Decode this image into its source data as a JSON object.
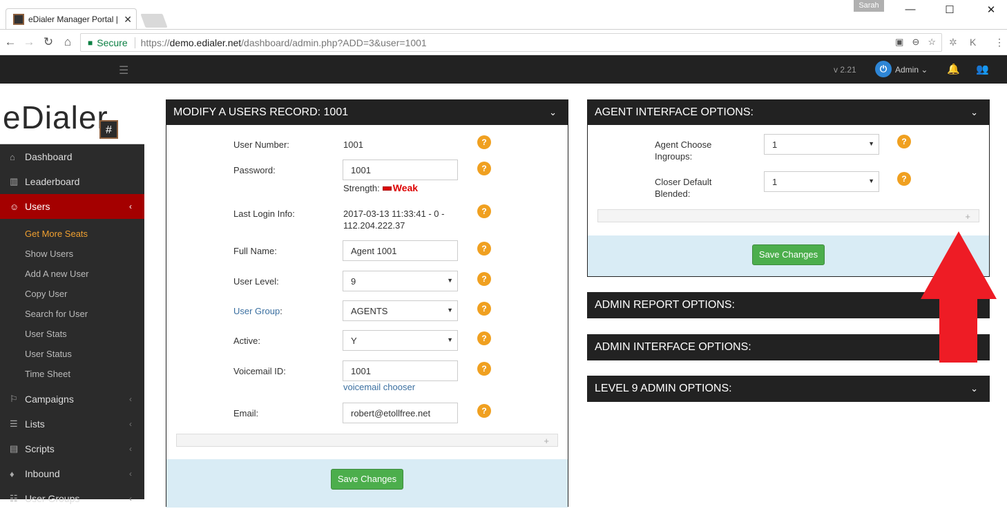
{
  "browser": {
    "tab_title": "eDialer Manager Portal |",
    "tab_close": "✕",
    "profile_name": "Sarah",
    "win_min": "—",
    "win_max": "☐",
    "win_close": "✕",
    "secure_label": "Secure",
    "url_scheme": "https://",
    "url_host": "demo.edialer.net",
    "url_path": "/dashboard/admin.php?ADD=3&user=1001"
  },
  "topbar": {
    "version": "v 2.21",
    "user_label": "Admin ⌄"
  },
  "sidebar": {
    "logo_text": "eDialer",
    "logo_hash": "#",
    "items": [
      {
        "label": "Dashboard",
        "icon": "⌂"
      },
      {
        "label": "Leaderboard",
        "icon": "▥"
      },
      {
        "label": "Users",
        "icon": "☺",
        "chev": "‹"
      },
      {
        "label": "Campaigns",
        "icon": "⚐",
        "chev": "‹"
      },
      {
        "label": "Lists",
        "icon": "☰",
        "chev": "‹"
      },
      {
        "label": "Scripts",
        "icon": "▤",
        "chev": "‹"
      },
      {
        "label": "Inbound",
        "icon": "♦",
        "chev": "‹"
      },
      {
        "label": "User Groups",
        "icon": "☷",
        "chev": "‹"
      }
    ],
    "sub_items": [
      "Get More Seats",
      "Show Users",
      "Add A new User",
      "Copy User",
      "Search for User",
      "User Stats",
      "User Status",
      "Time Sheet"
    ]
  },
  "modify_panel": {
    "title": "MODIFY A USERS RECORD: 1001",
    "user_number_label": "User Number:",
    "user_number_value": "1001",
    "password_label": "Password:",
    "password_value": "1001",
    "strength_label": "Strength:",
    "strength_value": "Weak",
    "last_login_label": "Last Login Info:",
    "last_login_line1": "2017-03-13 11:33:41 - 0 -",
    "last_login_line2": "112.204.222.37",
    "full_name_label": "Full Name:",
    "full_name_value": "Agent 1001",
    "user_level_label": "User Level:",
    "user_level_value": "9",
    "user_group_label": "User Group",
    "user_group_colon": ":",
    "user_group_value": "AGENTS",
    "active_label": "Active:",
    "active_value": "Y",
    "voicemail_label": "Voicemail ID:",
    "voicemail_value": "1001",
    "voicemail_chooser": "voicemail chooser",
    "email_label": "Email:",
    "email_value": "robert@etollfree.net",
    "save_label": "Save Changes"
  },
  "agent_panel": {
    "title": "AGENT INTERFACE OPTIONS:",
    "choose_ingroups_label_1": "Agent Choose",
    "choose_ingroups_label_2": "Ingroups:",
    "choose_ingroups_value": "1",
    "closer_label_1": "Closer Default",
    "closer_label_2": "Blended:",
    "closer_value": "1",
    "save_label": "Save Changes"
  },
  "collapsed_panels": {
    "admin_report": "ADMIN REPORT OPTIONS:",
    "admin_interface": "ADMIN INTERFACE OPTIONS:",
    "level9": "LEVEL 9 ADMIN OPTIONS:"
  },
  "glyphs": {
    "help": "?",
    "chevron_down": "⌄",
    "select_arrow": "▼",
    "plus": "+"
  },
  "colors": {
    "brand_dark": "#222222",
    "active_nav": "#a40000",
    "highlight_sub": "#f0a030",
    "help_orange": "#f0a020",
    "save_green": "#4cae4c",
    "annotation_arrow": "#ee1c25"
  }
}
